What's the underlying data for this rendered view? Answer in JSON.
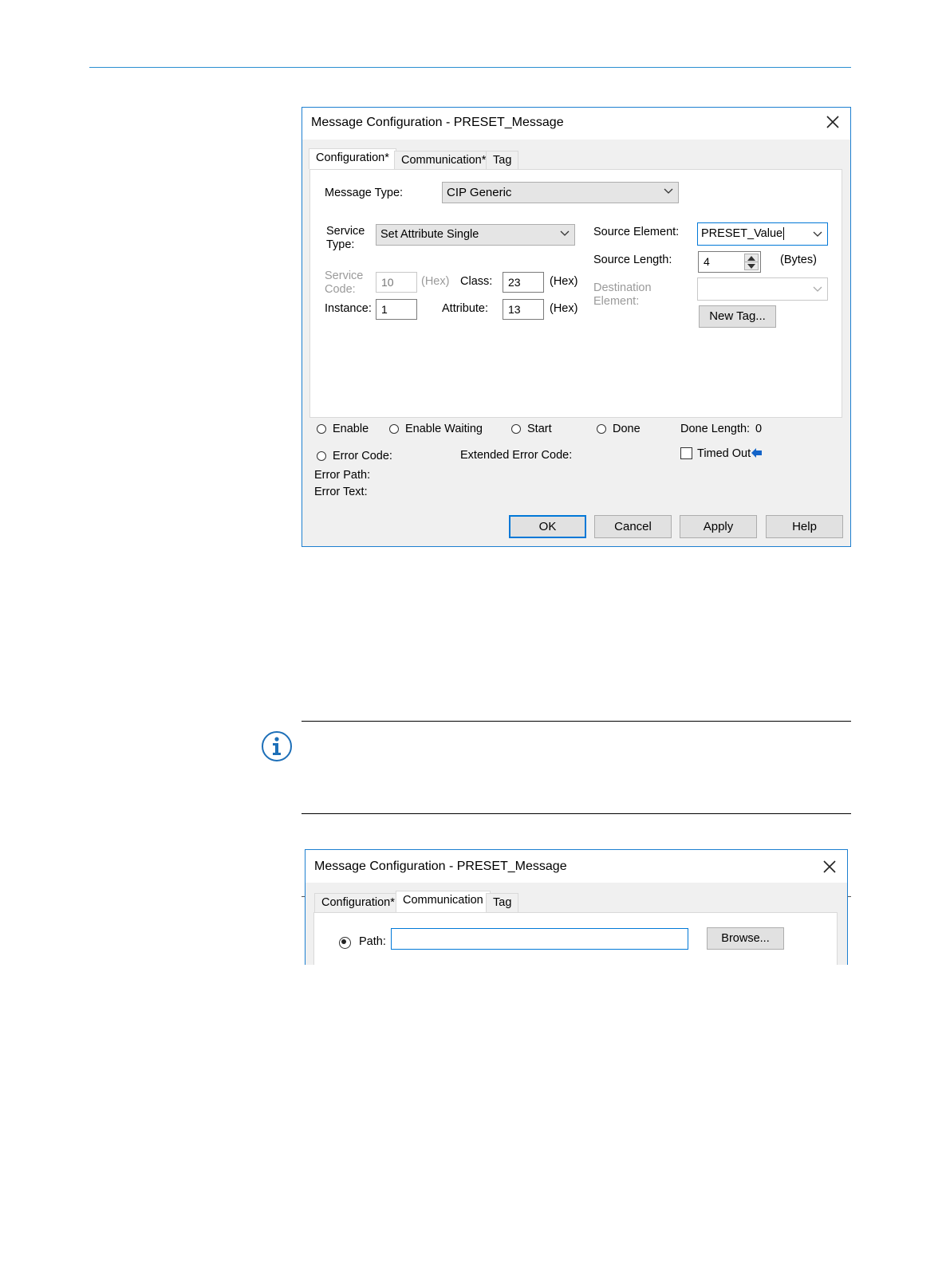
{
  "colors": {
    "accent": "#1d7fd0",
    "rule": "#2a8fd0",
    "note_icon": "#1d6fb8"
  },
  "dialog1": {
    "title": "Message Configuration - PRESET_Message",
    "close_icon": "close-icon",
    "tabs": [
      "Configuration*",
      "Communication*",
      "Tag"
    ],
    "active_tab": "Configuration*",
    "message_type_label": "Message Type:",
    "message_type_value": "CIP Generic",
    "service_type_label_1": "Service",
    "service_type_label_2": "Type:",
    "service_type_value": "Set Attribute Single",
    "source_element_label": "Source Element:",
    "source_element_value": "PRESET_Value",
    "source_length_label": "Source Length:",
    "source_length_value": "4",
    "bytes_label": "(Bytes)",
    "service_code_label_1": "Service",
    "service_code_label_2": "Code:",
    "service_code_value": "10",
    "hex_label_dis": "(Hex)",
    "class_label": "Class:",
    "class_value": "23",
    "hex_label_1": "(Hex)",
    "destination_label_1": "Destination",
    "destination_label_2": "Element:",
    "instance_label": "Instance:",
    "instance_value": "1",
    "attribute_label": "Attribute:",
    "attribute_value": "13",
    "hex_label_2": "(Hex)",
    "new_tag_button": "New Tag...",
    "status": {
      "enable": "Enable",
      "enable_waiting": "Enable Waiting",
      "start": "Start",
      "done": "Done",
      "done_length_label": "Done Length:",
      "done_length_value": "0",
      "error_code": "Error Code:",
      "extended_error_code": "Extended Error Code:",
      "timed_out": "Timed Out",
      "error_path": "Error Path:",
      "error_text": "Error Text:"
    },
    "buttons": {
      "ok": "OK",
      "cancel": "Cancel",
      "apply": "Apply",
      "help": "Help"
    }
  },
  "dialog2": {
    "title": "Message Configuration - PRESET_Message",
    "tabs": [
      "Configuration*",
      "Communication",
      "Tag"
    ],
    "active_tab": "Communication",
    "path_label": "Path:",
    "path_value": "",
    "browse_button": "Browse..."
  }
}
